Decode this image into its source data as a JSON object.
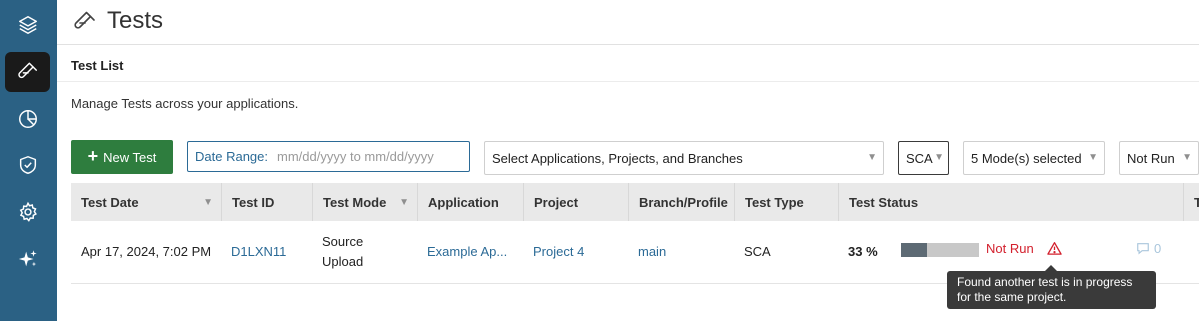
{
  "page": {
    "title": "Tests"
  },
  "sidebar": {
    "items": [
      {
        "icon": "layers-icon"
      },
      {
        "icon": "test-tube-icon",
        "active": true
      },
      {
        "icon": "pie-chart-icon"
      },
      {
        "icon": "shield-check-icon"
      },
      {
        "icon": "gear-icon"
      },
      {
        "icon": "sparkles-icon"
      }
    ]
  },
  "section": {
    "title": "Test List",
    "description": "Manage Tests across your applications."
  },
  "toolbar": {
    "new_test_label": "New Test",
    "date_range_label": "Date Range:",
    "date_range_placeholder": "mm/dd/yyyy to mm/dd/yyyy",
    "applications_select": "Select Applications, Projects, and Branches",
    "type_select": "SCA",
    "modes_select": "5 Mode(s) selected",
    "status_select": "Not Run"
  },
  "table": {
    "columns": [
      "Test Date",
      "Test ID",
      "Test Mode",
      "Application",
      "Project",
      "Branch/Profile",
      "Test Type",
      "Test Status",
      "T"
    ],
    "rows": [
      {
        "test_date": "Apr 17, 2024, 7:02 PM",
        "test_id": "D1LXN11",
        "test_mode": "Source Upload",
        "application": "Example Ap...",
        "project": "Project 4",
        "branch": "main",
        "test_type": "SCA",
        "progress_pct": "33 %",
        "progress_value": 0.33,
        "status": "Not Run",
        "comments": "0"
      }
    ]
  },
  "tooltip": {
    "text": "Found another test is in progress for the same project."
  },
  "colors": {
    "sidebar": "#2b6184",
    "primary_button": "#2e7d3e",
    "link": "#2b6a96",
    "error": "#d3202d"
  }
}
